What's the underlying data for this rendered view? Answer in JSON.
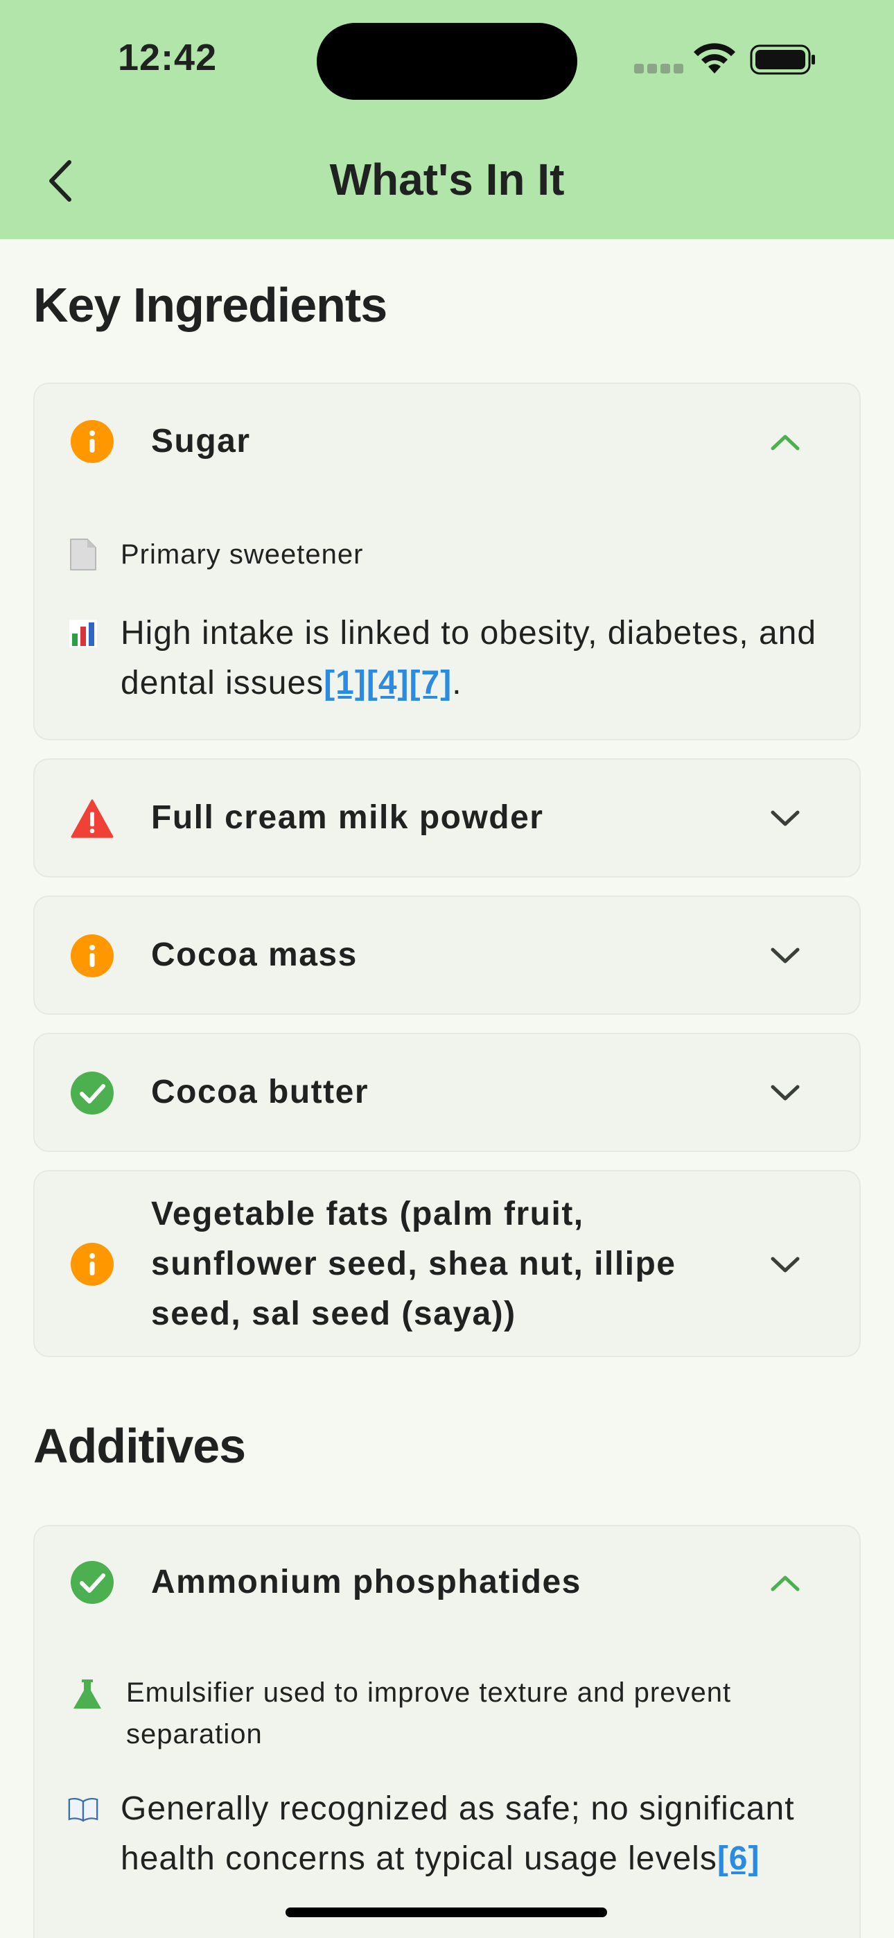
{
  "status_bar": {
    "time": "12:42"
  },
  "header": {
    "title": "What's In It",
    "back_icon": "chevron-left-icon"
  },
  "colors": {
    "header_bg": "#b2e5a9",
    "info": "#ff9800",
    "warning": "#ef4136",
    "safe": "#4caf50",
    "link": "#2a8be0"
  },
  "key_ingredients": {
    "title": "Key Ingredients",
    "items": [
      {
        "name": "Sugar",
        "status_icon": "info-icon",
        "expanded": true,
        "details": [
          {
            "icon": "document-icon",
            "text": "Primary sweetener"
          },
          {
            "icon": "bar-chart-icon",
            "text": "High intake is linked to obesity, diabetes, and dental issues",
            "refs": [
              "[1]",
              "[4]",
              "[7]"
            ],
            "suffix": "."
          }
        ]
      },
      {
        "name": "Full cream milk powder",
        "status_icon": "warning-icon",
        "expanded": false
      },
      {
        "name": "Cocoa mass",
        "status_icon": "info-icon",
        "expanded": false
      },
      {
        "name": "Cocoa butter",
        "status_icon": "check-icon",
        "expanded": false
      },
      {
        "name": "Vegetable fats (palm fruit, sunflower seed, shea nut, illipe seed, sal seed (saya))",
        "status_icon": "info-icon",
        "expanded": false
      }
    ]
  },
  "additives": {
    "title": "Additives",
    "items": [
      {
        "name": "Ammonium phosphatides",
        "status_icon": "check-icon",
        "expanded": true,
        "details": [
          {
            "icon": "flask-icon",
            "text": "Emulsifier used to improve texture and prevent separation"
          },
          {
            "icon": "book-icon",
            "text": "Generally recognized as safe; no significant health concerns at typical usage levels",
            "refs": [
              "[6]"
            ]
          }
        ]
      }
    ]
  }
}
